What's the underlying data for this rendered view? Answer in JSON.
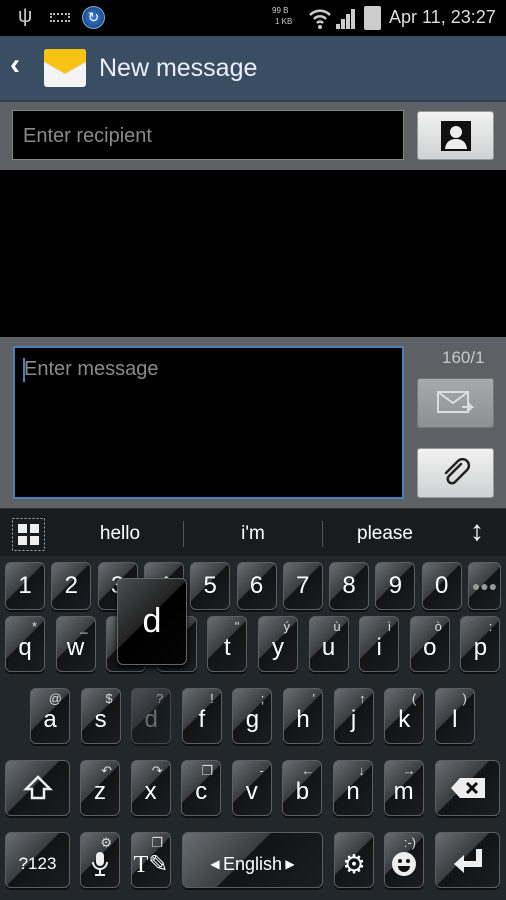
{
  "status_bar": {
    "net_up": "99 B",
    "net_down": "1 KB",
    "datetime": "Apr 11, 23:27",
    "icons": [
      "usb-icon",
      "keyboard-icon",
      "sync-icon",
      "wifi-icon",
      "signal-icon",
      "battery-icon"
    ]
  },
  "header": {
    "title": "New message"
  },
  "recipient": {
    "placeholder": "Enter recipient",
    "value": ""
  },
  "compose": {
    "placeholder": "Enter message",
    "value": "",
    "counter": "160/1"
  },
  "suggestions": [
    "hello",
    "i'm",
    "please"
  ],
  "keyboard": {
    "number_row": [
      "1",
      "2",
      "3",
      "4",
      "5",
      "6",
      "7",
      "8",
      "9",
      "0"
    ],
    "row1": [
      {
        "k": "q",
        "a": "*"
      },
      {
        "k": "w",
        "a": "_"
      },
      {
        "k": "e",
        "a": ""
      },
      {
        "k": "r",
        "a": ""
      },
      {
        "k": "t",
        "a": "\""
      },
      {
        "k": "y",
        "a": "ý"
      },
      {
        "k": "u",
        "a": "ù"
      },
      {
        "k": "i",
        "a": "ì"
      },
      {
        "k": "o",
        "a": "ò"
      },
      {
        "k": "p",
        "a": ":"
      }
    ],
    "row2": [
      {
        "k": "a",
        "a": "@"
      },
      {
        "k": "s",
        "a": "$"
      },
      {
        "k": "d",
        "a": "?"
      },
      {
        "k": "f",
        "a": "!"
      },
      {
        "k": "g",
        "a": ";"
      },
      {
        "k": "h",
        "a": "'"
      },
      {
        "k": "j",
        "a": "↑"
      },
      {
        "k": "k",
        "a": "("
      },
      {
        "k": "l",
        "a": ")"
      }
    ],
    "row3": [
      {
        "k": "z",
        "a": "↶"
      },
      {
        "k": "x",
        "a": "↷"
      },
      {
        "k": "c",
        "a": "❐"
      },
      {
        "k": "v",
        "a": "-"
      },
      {
        "k": "b",
        "a": "←"
      },
      {
        "k": "n",
        "a": "↓"
      },
      {
        "k": "m",
        "a": "→"
      }
    ],
    "symbols_label": "?123",
    "space_label": "English",
    "emoji_alt": ":-)",
    "popup_key": "d",
    "pressed_key": "d"
  },
  "colors": {
    "header": "#3a4e63",
    "focus_border": "#4a82b8",
    "keyboard_bg": "#22272b"
  }
}
